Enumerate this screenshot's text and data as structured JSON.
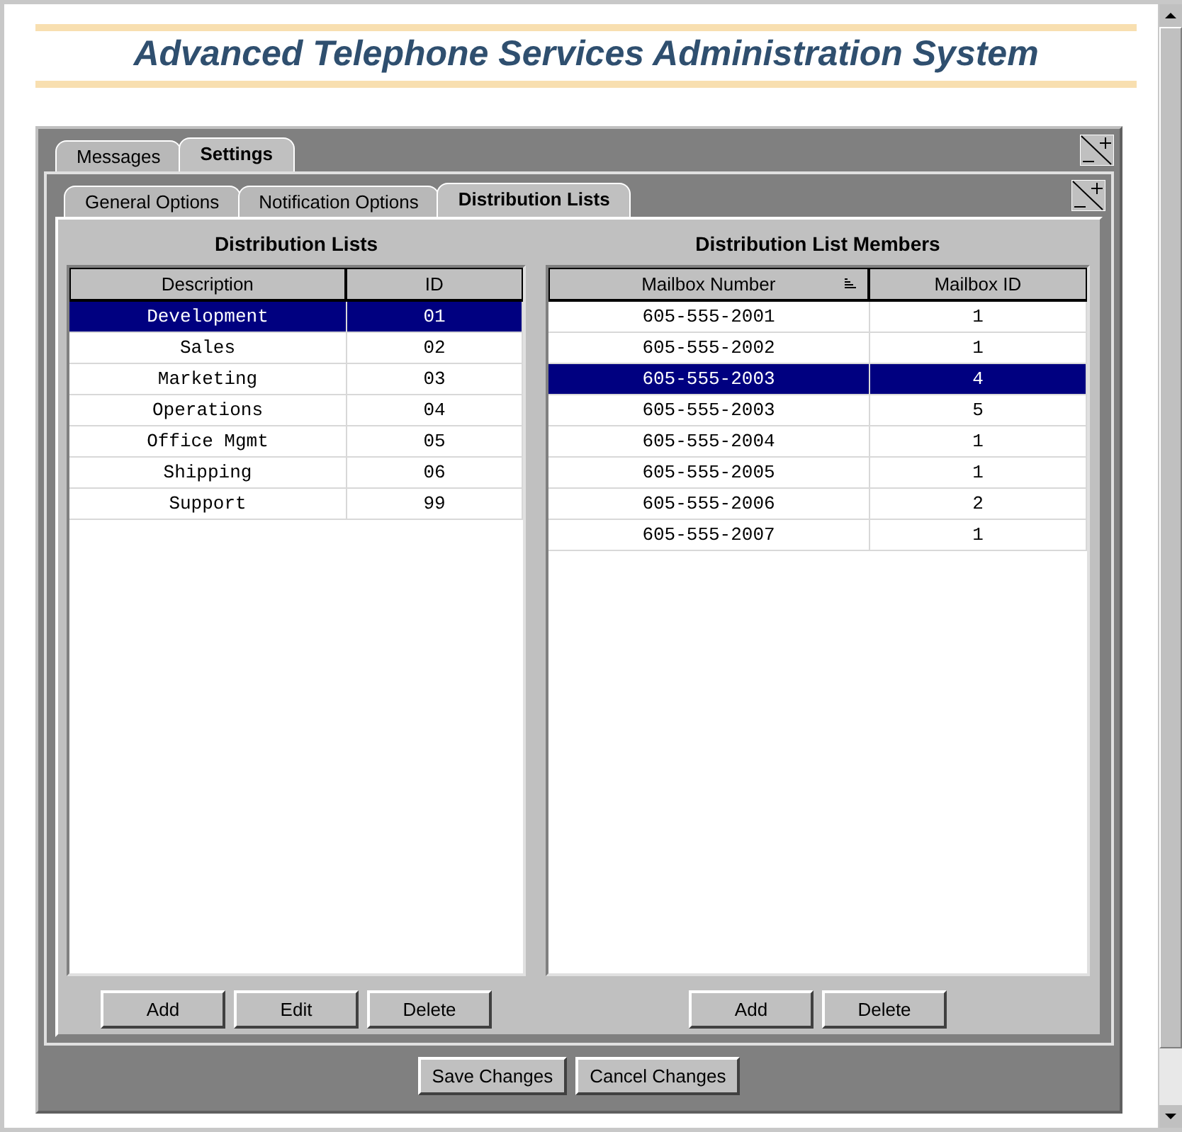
{
  "title": "Advanced Telephone Services Administration System",
  "tabs": [
    {
      "label": "Messages",
      "selected": false
    },
    {
      "label": "Settings",
      "selected": true
    }
  ],
  "subtabs": [
    {
      "label": "General Options",
      "selected": false
    },
    {
      "label": "Notification Options",
      "selected": false
    },
    {
      "label": "Distribution Lists",
      "selected": true
    }
  ],
  "lists": {
    "heading": "Distribution Lists",
    "columns": [
      "Description",
      "ID"
    ],
    "rows": [
      {
        "description": "Development",
        "id": "01",
        "selected": true
      },
      {
        "description": "Sales",
        "id": "02",
        "selected": false
      },
      {
        "description": "Marketing",
        "id": "03",
        "selected": false
      },
      {
        "description": "Operations",
        "id": "04",
        "selected": false
      },
      {
        "description": "Office Mgmt",
        "id": "05",
        "selected": false
      },
      {
        "description": "Shipping",
        "id": "06",
        "selected": false
      },
      {
        "description": "Support",
        "id": "99",
        "selected": false
      }
    ],
    "buttons": [
      "Add",
      "Edit",
      "Delete"
    ]
  },
  "members": {
    "heading": "Distribution List Members",
    "columns": [
      "Mailbox Number",
      "Mailbox ID"
    ],
    "rows": [
      {
        "number": "605-555-2001",
        "mailbox_id": "1",
        "selected": false
      },
      {
        "number": "605-555-2002",
        "mailbox_id": "1",
        "selected": false
      },
      {
        "number": "605-555-2003",
        "mailbox_id": "4",
        "selected": true
      },
      {
        "number": "605-555-2003",
        "mailbox_id": "5",
        "selected": false
      },
      {
        "number": "605-555-2004",
        "mailbox_id": "1",
        "selected": false
      },
      {
        "number": "605-555-2005",
        "mailbox_id": "1",
        "selected": false
      },
      {
        "number": "605-555-2006",
        "mailbox_id": "2",
        "selected": false
      },
      {
        "number": "605-555-2007",
        "mailbox_id": "1",
        "selected": false
      }
    ],
    "buttons": [
      "Add",
      "Delete"
    ]
  },
  "footer_buttons": [
    "Save Changes",
    "Cancel Changes"
  ]
}
